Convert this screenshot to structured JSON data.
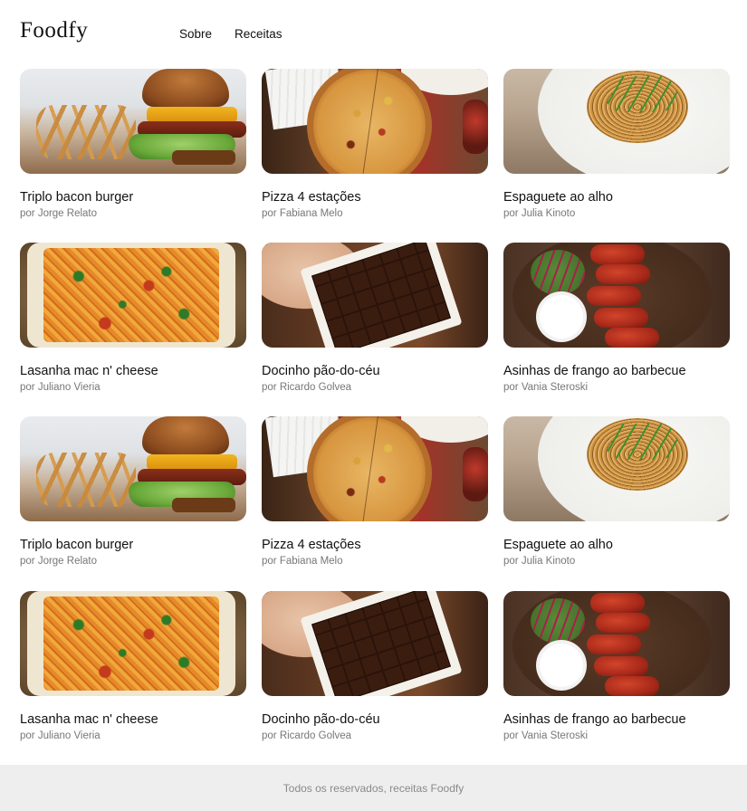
{
  "header": {
    "logo": "Foodfy",
    "nav": [
      "Sobre",
      "Receitas"
    ]
  },
  "recipes": [
    {
      "title": "Triplo bacon burger",
      "author": "por Jorge Relato",
      "image": "burger"
    },
    {
      "title": "Pizza 4 estações",
      "author": "por Fabiana Melo",
      "image": "pizza"
    },
    {
      "title": "Espaguete ao alho",
      "author": "por Julia Kinoto",
      "image": "spaghetti"
    },
    {
      "title": "Lasanha mac n' cheese",
      "author": "por Juliano Vieria",
      "image": "lasagna"
    },
    {
      "title": "Docinho pão-do-céu",
      "author": "por Ricardo Golvea",
      "image": "chocolate"
    },
    {
      "title": "Asinhas de frango ao barbecue",
      "author": "por Vania Steroski",
      "image": "wings"
    },
    {
      "title": "Triplo bacon burger",
      "author": "por Jorge Relato",
      "image": "burger"
    },
    {
      "title": "Pizza 4 estações",
      "author": "por Fabiana Melo",
      "image": "pizza"
    },
    {
      "title": "Espaguete ao alho",
      "author": "por Julia Kinoto",
      "image": "spaghetti"
    },
    {
      "title": "Lasanha mac n' cheese",
      "author": "por Juliano Vieria",
      "image": "lasagna"
    },
    {
      "title": "Docinho pão-do-céu",
      "author": "por Ricardo Golvea",
      "image": "chocolate"
    },
    {
      "title": "Asinhas de frango ao barbecue",
      "author": "por Vania Steroski",
      "image": "wings"
    }
  ],
  "footer": {
    "text": "Todos os reservados, receitas Foodfy"
  },
  "colors": {
    "text": "#111111",
    "author": "#777777",
    "footer_bg": "#eeeeee",
    "footer_text": "#8a8a8a"
  }
}
